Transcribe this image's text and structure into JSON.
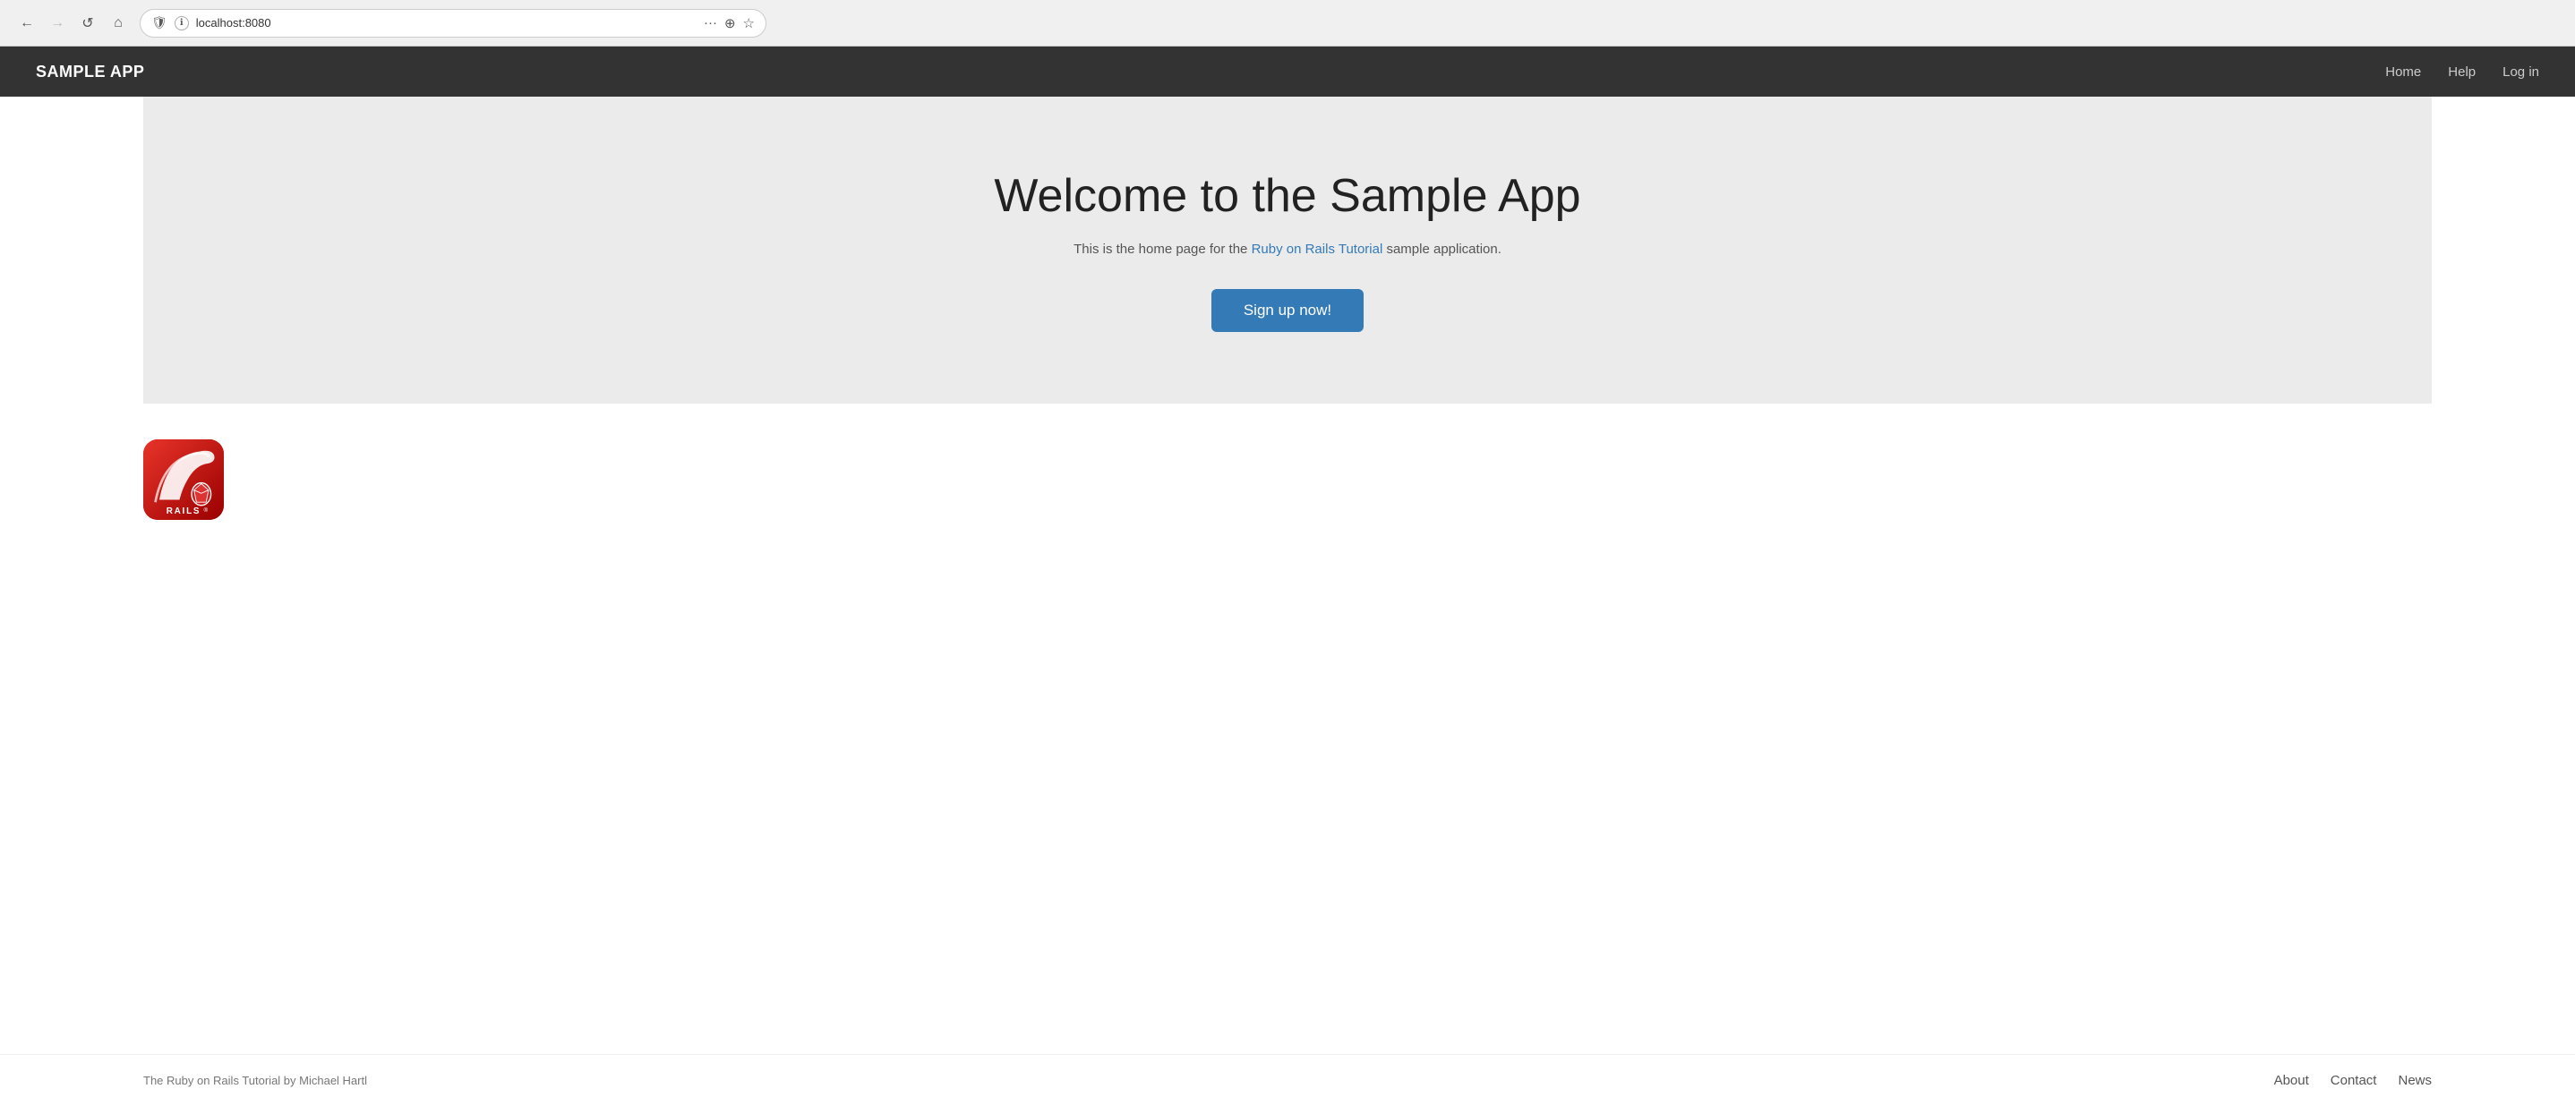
{
  "browser": {
    "url": "localhost:8080",
    "back_btn": "←",
    "forward_btn": "→",
    "reload_btn": "↺",
    "home_btn": "⌂",
    "ellipsis": "···",
    "pocket_icon": "☆",
    "star_icon": "★"
  },
  "navbar": {
    "brand": "SAMPLE APP",
    "links": [
      {
        "label": "Home",
        "href": "#"
      },
      {
        "label": "Help",
        "href": "#"
      },
      {
        "label": "Log in",
        "href": "#"
      }
    ]
  },
  "hero": {
    "title": "Welcome to the Sample App",
    "subtitle_before": "This is the home page for the ",
    "subtitle_link": "Ruby on Rails Tutorial",
    "subtitle_after": " sample application.",
    "signup_btn": "Sign up now!"
  },
  "footer": {
    "text_before": "The Ruby on Rails Tutorial by ",
    "author": "Michael Hartl",
    "links": [
      {
        "label": "About"
      },
      {
        "label": "Contact"
      },
      {
        "label": "News"
      }
    ]
  }
}
